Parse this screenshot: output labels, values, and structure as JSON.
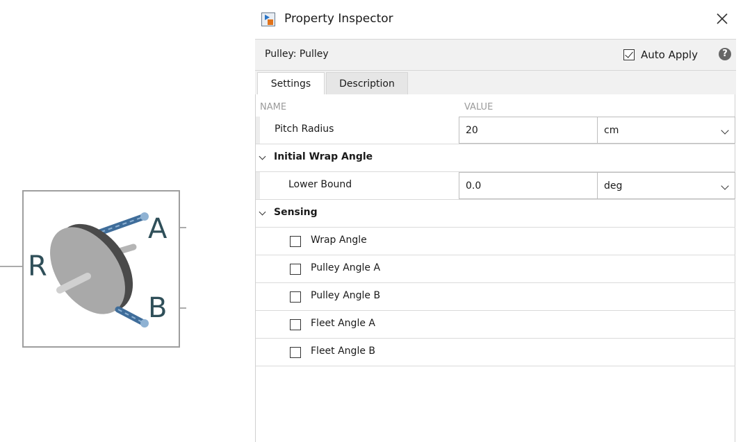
{
  "block": {
    "ports": {
      "r": "R",
      "a": "A",
      "b": "B"
    }
  },
  "inspector": {
    "title": "Property Inspector",
    "block_name": "Pulley: Pulley",
    "auto_apply_label": "Auto Apply",
    "auto_apply_checked": true,
    "help_glyph": "?",
    "tabs": [
      {
        "label": "Settings",
        "active": true
      },
      {
        "label": "Description",
        "active": false
      }
    ],
    "columns": {
      "name": "NAME",
      "value": "VALUE"
    },
    "params": {
      "pitch_radius": {
        "label": "Pitch Radius",
        "value": "20",
        "unit": "cm"
      }
    },
    "groups": {
      "initial_wrap_angle": {
        "label": "Initial Wrap Angle",
        "lower_bound": {
          "label": "Lower Bound",
          "value": "0.0",
          "unit": "deg"
        }
      },
      "sensing": {
        "label": "Sensing",
        "items": [
          {
            "label": "Wrap Angle",
            "checked": false
          },
          {
            "label": "Pulley Angle A",
            "checked": false
          },
          {
            "label": "Pulley Angle B",
            "checked": false
          },
          {
            "label": "Fleet Angle A",
            "checked": false
          },
          {
            "label": "Fleet Angle B",
            "checked": false
          }
        ]
      }
    }
  },
  "icons": [
    "app-icon",
    "close-icon",
    "help-icon",
    "chevron-down-icon",
    "checkbox-icon"
  ],
  "colors": {
    "port_text": "#2f4f59",
    "belt": "#3f6d9a",
    "disc": "#a7a7a7",
    "panel_gray": "#f1f1f1"
  }
}
